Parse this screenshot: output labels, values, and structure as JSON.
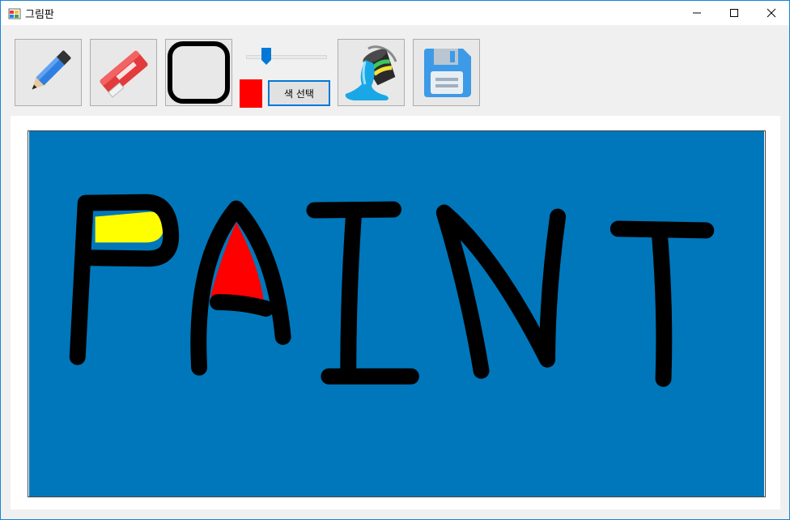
{
  "window": {
    "title": "그림판"
  },
  "titlebar": {
    "icons": [
      "app-icon",
      "minimize-icon",
      "maximize-icon",
      "close-icon"
    ]
  },
  "toolbar": {
    "tools": [
      {
        "name": "pencil",
        "icon": "pencil-icon"
      },
      {
        "name": "eraser",
        "icon": "eraser-icon"
      },
      {
        "name": "shape",
        "icon": "rounded-rectangle-icon"
      },
      {
        "name": "fill",
        "icon": "paint-bucket-icon"
      },
      {
        "name": "save",
        "icon": "floppy-disk-icon"
      }
    ],
    "brush_size_slider": {
      "value_fraction": 0.22
    },
    "current_color": "#ff0000",
    "color_button_label": "색 선택"
  },
  "canvas": {
    "background_color": "#0077bb",
    "drawing_text": "PAINT",
    "stroke_color": "#000000",
    "fill_colors": [
      "#ffff00",
      "#ff0000"
    ]
  }
}
